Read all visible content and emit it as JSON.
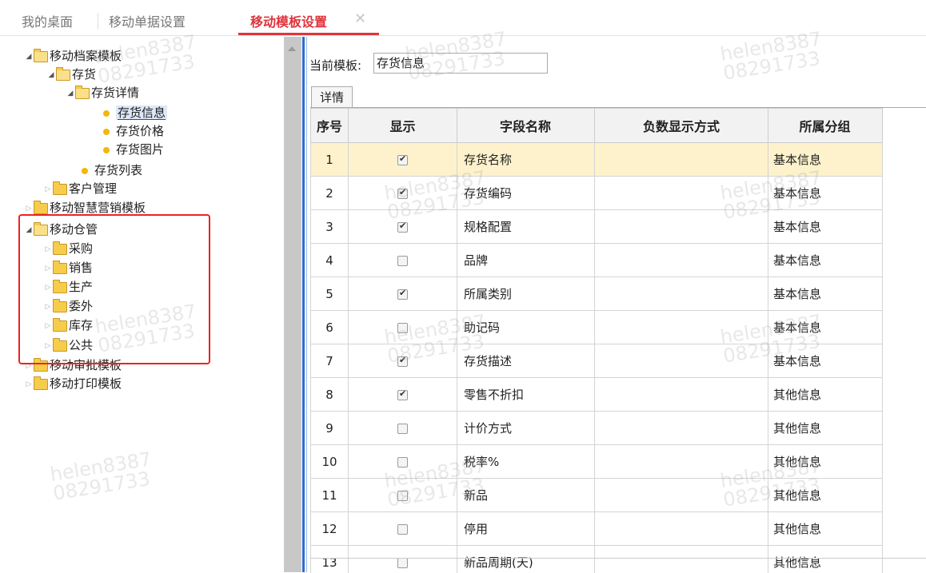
{
  "tabs": [
    {
      "label": "我的桌面"
    },
    {
      "label": "移动单据设置"
    },
    {
      "label": "移动模板设置",
      "close": "✕"
    }
  ],
  "tree": {
    "root1": "移动档案模板",
    "inv": "存货",
    "inv_detail": "存货详情",
    "inv_info": "存货信息",
    "inv_price": "存货价格",
    "inv_image": "存货图片",
    "inv_list": "存货列表",
    "customer": "客户管理",
    "smart": "移动智慧营销模板",
    "warehouse": "移动仓管",
    "purchase": "采购",
    "sales": "销售",
    "production": "生产",
    "outsource": "委外",
    "stock": "库存",
    "common": "公共",
    "approval": "移动审批模板",
    "print": "移动打印模板"
  },
  "current_template": {
    "label": "当前模板:",
    "value": "存货信息"
  },
  "subtab": "详情",
  "grid": {
    "headers": [
      "序号",
      "显示",
      "字段名称",
      "负数显示方式",
      "所属分组"
    ],
    "rows": [
      {
        "no": "1",
        "show": true,
        "name": "存货名称",
        "neg": "",
        "group": "基本信息"
      },
      {
        "no": "2",
        "show": true,
        "name": "存货编码",
        "neg": "",
        "group": "基本信息"
      },
      {
        "no": "3",
        "show": true,
        "name": "规格配置",
        "neg": "",
        "group": "基本信息"
      },
      {
        "no": "4",
        "show": false,
        "name": "品牌",
        "neg": "",
        "group": "基本信息"
      },
      {
        "no": "5",
        "show": true,
        "name": "所属类别",
        "neg": "",
        "group": "基本信息"
      },
      {
        "no": "6",
        "show": false,
        "name": "助记码",
        "neg": "",
        "group": "基本信息"
      },
      {
        "no": "7",
        "show": true,
        "name": "存货描述",
        "neg": "",
        "group": "基本信息"
      },
      {
        "no": "8",
        "show": true,
        "name": "零售不折扣",
        "neg": "",
        "group": "其他信息"
      },
      {
        "no": "9",
        "show": false,
        "name": "计价方式",
        "neg": "",
        "group": "其他信息"
      },
      {
        "no": "10",
        "show": false,
        "name": "税率%",
        "neg": "",
        "group": "其他信息"
      },
      {
        "no": "11",
        "show": false,
        "name": "新品",
        "neg": "",
        "group": "其他信息"
      },
      {
        "no": "12",
        "show": false,
        "name": "停用",
        "neg": "",
        "group": "其他信息"
      },
      {
        "no": "13",
        "show": false,
        "name": "新品周期(天)",
        "neg": "",
        "group": "其他信息"
      }
    ]
  },
  "watermark": "helen8387\n08291733",
  "colors": {
    "accent": "#e0333b",
    "highlight_row": "#fdf2cc",
    "annotation_box": "#ee2222"
  }
}
